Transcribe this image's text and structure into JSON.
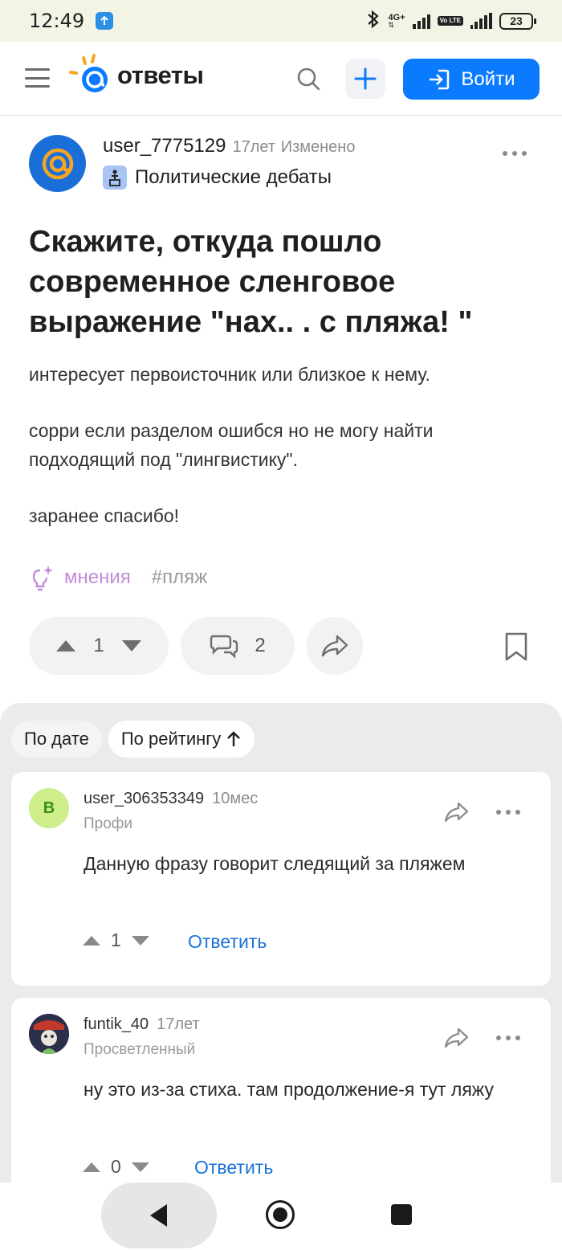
{
  "status_bar": {
    "time": "12:49",
    "network_label": "4G+",
    "volte_label": "Vo LTE",
    "battery": "23"
  },
  "header": {
    "logo_text": "ответы",
    "login_label": "Войти",
    "accent_color": "#0a7bff",
    "logo_orange": "#f5a623"
  },
  "question": {
    "author": "user_7775129",
    "age": "17лет",
    "edited_label": "Изменено",
    "category": "Политические дебаты",
    "title": "Скажите, откуда пошло современное сленговое выражение \"нах.. . с пляжа! \"",
    "body": [
      "интересует первоисточник или близкое к нему.",
      "сорри если разделом ошибся но не могу найти подходящий под \"лингвистику\".",
      "заранее спасибо!"
    ],
    "tag_opinion": "мнения",
    "tag_hash": "#пляж",
    "votes": "1",
    "comments": "2"
  },
  "sort": {
    "by_date": "По дате",
    "by_rating": "По рейтингу"
  },
  "answers": [
    {
      "avatar_letter": "В",
      "author": "user_306353349",
      "time": "10мес",
      "rank": "Профи",
      "text": "Данную фразу говорит следящий за пляжем",
      "votes": "1",
      "reply_label": "Ответить"
    },
    {
      "author": "funtik_40",
      "time": "17лет",
      "rank": "Просветленный",
      "text": "ну это из-за стиха. там продолжение-я тут ляжу",
      "votes": "0",
      "reply_label": "Ответить"
    }
  ]
}
